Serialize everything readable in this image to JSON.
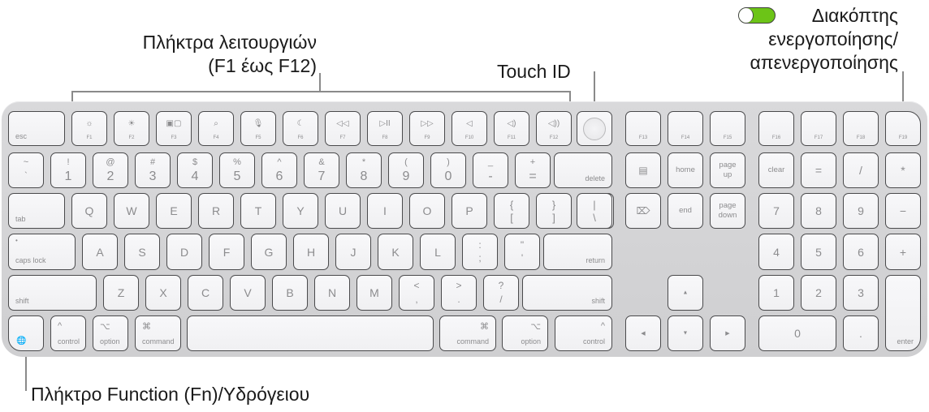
{
  "callouts": {
    "function_keys": [
      "Πλήκτρα λειτουργιών",
      "(F1 έως F12)"
    ],
    "touch_id": "Touch ID",
    "power_switch": [
      "Διακόπτης",
      "ενεργοποίησης/",
      "απενεργοποίησης"
    ],
    "fn_globe_key": "Πλήκτρο Function (Fn)/Υδρόγειου"
  },
  "colors": {
    "toggle_on": "#6cc417",
    "board": "#d3d3d5",
    "key": "#f4f4f6",
    "key_text": "#8c8c8e"
  },
  "keys": {
    "esc": "esc",
    "f_keys": [
      {
        "icon": "☼",
        "label": "F1",
        "name": "brightness-down-icon"
      },
      {
        "icon": "☀",
        "label": "F2",
        "name": "brightness-up-icon"
      },
      {
        "icon": "▣▢",
        "label": "F3",
        "name": "mission-control-icon"
      },
      {
        "icon": "⌕",
        "label": "F4",
        "name": "spotlight-search-icon"
      },
      {
        "icon": "🎙",
        "label": "F5",
        "name": "dictation-mic-icon"
      },
      {
        "icon": "☾",
        "label": "F6",
        "name": "do-not-disturb-moon-icon"
      },
      {
        "icon": "◁◁",
        "label": "F7",
        "name": "rewind-icon"
      },
      {
        "icon": "▷II",
        "label": "F8",
        "name": "play-pause-icon"
      },
      {
        "icon": "▷▷",
        "label": "F9",
        "name": "fast-forward-icon"
      },
      {
        "icon": "◁",
        "label": "F10",
        "name": "mute-icon"
      },
      {
        "icon": "◁)",
        "label": "F11",
        "name": "volume-down-icon"
      },
      {
        "icon": "◁))",
        "label": "F12",
        "name": "volume-up-icon"
      }
    ],
    "f_ext": [
      "F13",
      "F14",
      "F15",
      "F16",
      "F17",
      "F18",
      "F19"
    ],
    "number_row": [
      {
        "top": "~",
        "bot": "`"
      },
      {
        "top": "!",
        "bot": "1"
      },
      {
        "top": "@",
        "bot": "2"
      },
      {
        "top": "#",
        "bot": "3"
      },
      {
        "top": "$",
        "bot": "4"
      },
      {
        "top": "%",
        "bot": "5"
      },
      {
        "top": "^",
        "bot": "6"
      },
      {
        "top": "&",
        "bot": "7"
      },
      {
        "top": "*",
        "bot": "8"
      },
      {
        "top": "(",
        "bot": "9"
      },
      {
        "top": ")",
        "bot": "0"
      },
      {
        "top": "_",
        "bot": "-"
      },
      {
        "top": "+",
        "bot": "="
      }
    ],
    "delete": "delete",
    "tab": "tab",
    "qwerty_row": [
      "Q",
      "W",
      "E",
      "R",
      "T",
      "Y",
      "U",
      "I",
      "O",
      "P"
    ],
    "bracket_keys": [
      {
        "top": "{",
        "bot": "["
      },
      {
        "top": "}",
        "bot": "]"
      },
      {
        "top": "|",
        "bot": "\\"
      }
    ],
    "caps_lock": "caps lock",
    "home_row": [
      "A",
      "S",
      "D",
      "F",
      "G",
      "H",
      "J",
      "K",
      "L"
    ],
    "home_punct": [
      {
        "top": ":",
        "bot": ";"
      },
      {
        "top": "\"",
        "bot": "'"
      }
    ],
    "return": "return",
    "shift": "shift",
    "bottom_letters": [
      "Z",
      "X",
      "C",
      "V",
      "B",
      "N",
      "M"
    ],
    "bottom_punct": [
      {
        "top": "<",
        "bot": ","
      },
      {
        "top": ">",
        "bot": "."
      },
      {
        "top": "?",
        "bot": "/"
      }
    ],
    "control": "control",
    "option": "option",
    "command": "command",
    "control_sym": "^",
    "option_sym": "⌥",
    "command_sym": "⌘",
    "globe_sym": "🌐",
    "nav": {
      "doc_icon": "▤",
      "home": "home",
      "page_up": [
        "page",
        "up"
      ],
      "fwd_delete_icon": "⌦",
      "end": "end",
      "page_down": [
        "page",
        "down"
      ]
    },
    "arrows": {
      "up": "▲",
      "left": "◀",
      "down": "▼",
      "right": "▶"
    },
    "numpad": {
      "row1": [
        "clear",
        "=",
        "/",
        "*"
      ],
      "row2": [
        "7",
        "8",
        "9",
        "−"
      ],
      "row3": [
        "4",
        "5",
        "6",
        "+"
      ],
      "row4": [
        "1",
        "2",
        "3"
      ],
      "zero": "0",
      "dot": ".",
      "enter": "enter"
    }
  }
}
